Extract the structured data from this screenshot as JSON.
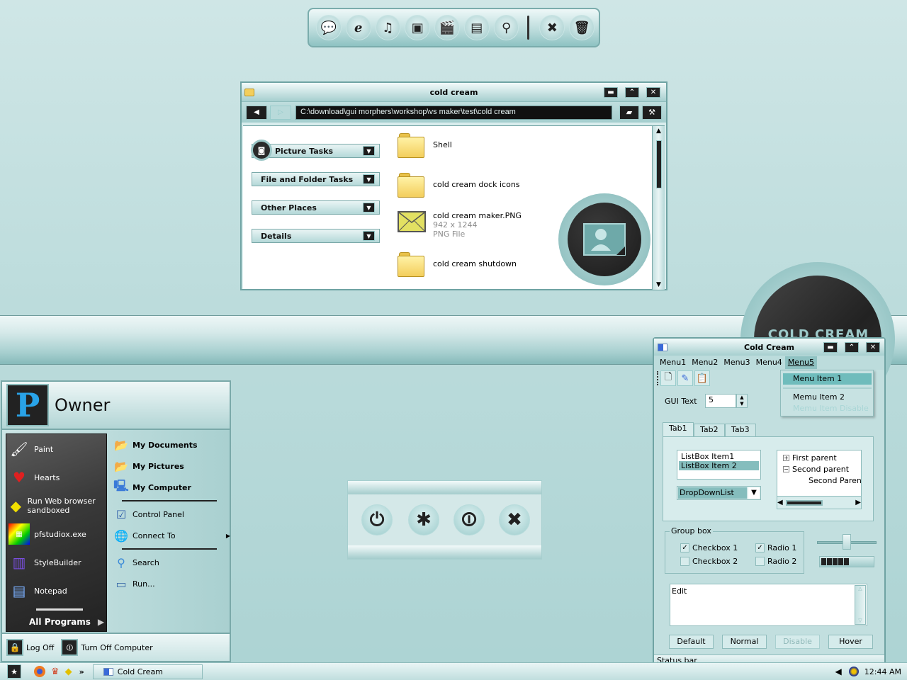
{
  "dock": {
    "items": [
      {
        "icon": "chat-icon",
        "glyph": "💬"
      },
      {
        "icon": "browser-icon",
        "glyph": "e"
      },
      {
        "icon": "music-icon",
        "glyph": "♫"
      },
      {
        "icon": "picture-icon",
        "glyph": "▣"
      },
      {
        "icon": "video-icon",
        "glyph": "🎬"
      },
      {
        "icon": "document-icon",
        "glyph": "▤"
      },
      {
        "icon": "search-icon",
        "glyph": "⚲"
      }
    ],
    "items_after_sep": [
      {
        "icon": "tools-icon",
        "glyph": "✖"
      },
      {
        "icon": "trash-icon",
        "glyph": "🗑"
      }
    ]
  },
  "explorer": {
    "title": "cold cream",
    "address": "C:\\download\\gui morphers\\workshop\\vs maker\\test\\cold cream",
    "tasks": [
      "Picture Tasks",
      "File and Folder Tasks",
      "Other Places",
      "Details"
    ],
    "files": [
      {
        "name": "Shell",
        "type": "folder"
      },
      {
        "name": "cold cream dock icons",
        "type": "folder"
      },
      {
        "name": "cold cream maker.PNG",
        "type": "image",
        "dims": "942 x 1244",
        "kind": "PNG File"
      },
      {
        "name": "cold cream shutdown",
        "type": "folder"
      }
    ]
  },
  "logo": {
    "text": "COLD CREAM"
  },
  "start_menu": {
    "user": "Owner",
    "avatar_letter": "P",
    "programs": [
      {
        "label": "Paint",
        "glyph": "🖌"
      },
      {
        "label": "Hearts",
        "glyph": "♥"
      },
      {
        "label": "Run Web browser sandboxed",
        "glyph": "◆"
      },
      {
        "label": "pfstudiox.exe",
        "glyph": "▦"
      },
      {
        "label": "StyleBuilder",
        "glyph": "▥"
      },
      {
        "label": "Notepad",
        "glyph": "▤"
      }
    ],
    "all_programs": "All Programs",
    "places_bold": [
      "My Documents",
      "My Pictures",
      "My Computer"
    ],
    "places": [
      "Control Panel",
      "Connect To",
      "Search",
      "Run..."
    ],
    "log_off": "Log Off",
    "turn_off": "Turn Off Computer"
  },
  "shutdown_panel": {
    "buttons": [
      {
        "icon": "power-icon",
        "glyph": "⏻"
      },
      {
        "icon": "restart-icon",
        "glyph": "✱"
      },
      {
        "icon": "standby-icon",
        "glyph": "⏼"
      },
      {
        "icon": "cancel-icon",
        "glyph": "✖"
      }
    ]
  },
  "demo_window": {
    "title": "Cold Cream",
    "menus": [
      "Menu1",
      "Menu2",
      "Menu3",
      "Menu4",
      "Menu5"
    ],
    "dropdown": {
      "item1": "Menu Item 1",
      "item2": "Memu Item 2",
      "disabled": "Memu Item Disable"
    },
    "gui_text_label": "GUI Text",
    "spin_value": "5",
    "tabs": [
      "Tab1",
      "Tab2",
      "Tab3"
    ],
    "listbox": [
      "ListBox Item1",
      "ListBox Item 2"
    ],
    "dropdownlist": "DropDownList",
    "tree": [
      "First parent",
      "Second parent",
      "Second Parent'"
    ],
    "groupbox_label": "Group box",
    "checkbox1": "Checkbox 1",
    "checkbox2": "Checkbox 2",
    "radio1": "Radio 1",
    "radio2": "Radio 2",
    "slider_value": 0.5,
    "progress_blocks": 5,
    "edit_text": "Edit",
    "buttons": [
      "Default",
      "Normal",
      "Disable",
      "Hover"
    ],
    "status": "Status bar"
  },
  "taskbar": {
    "task": "Cold Cream",
    "clock": "12:44 AM",
    "overflow": "»"
  }
}
